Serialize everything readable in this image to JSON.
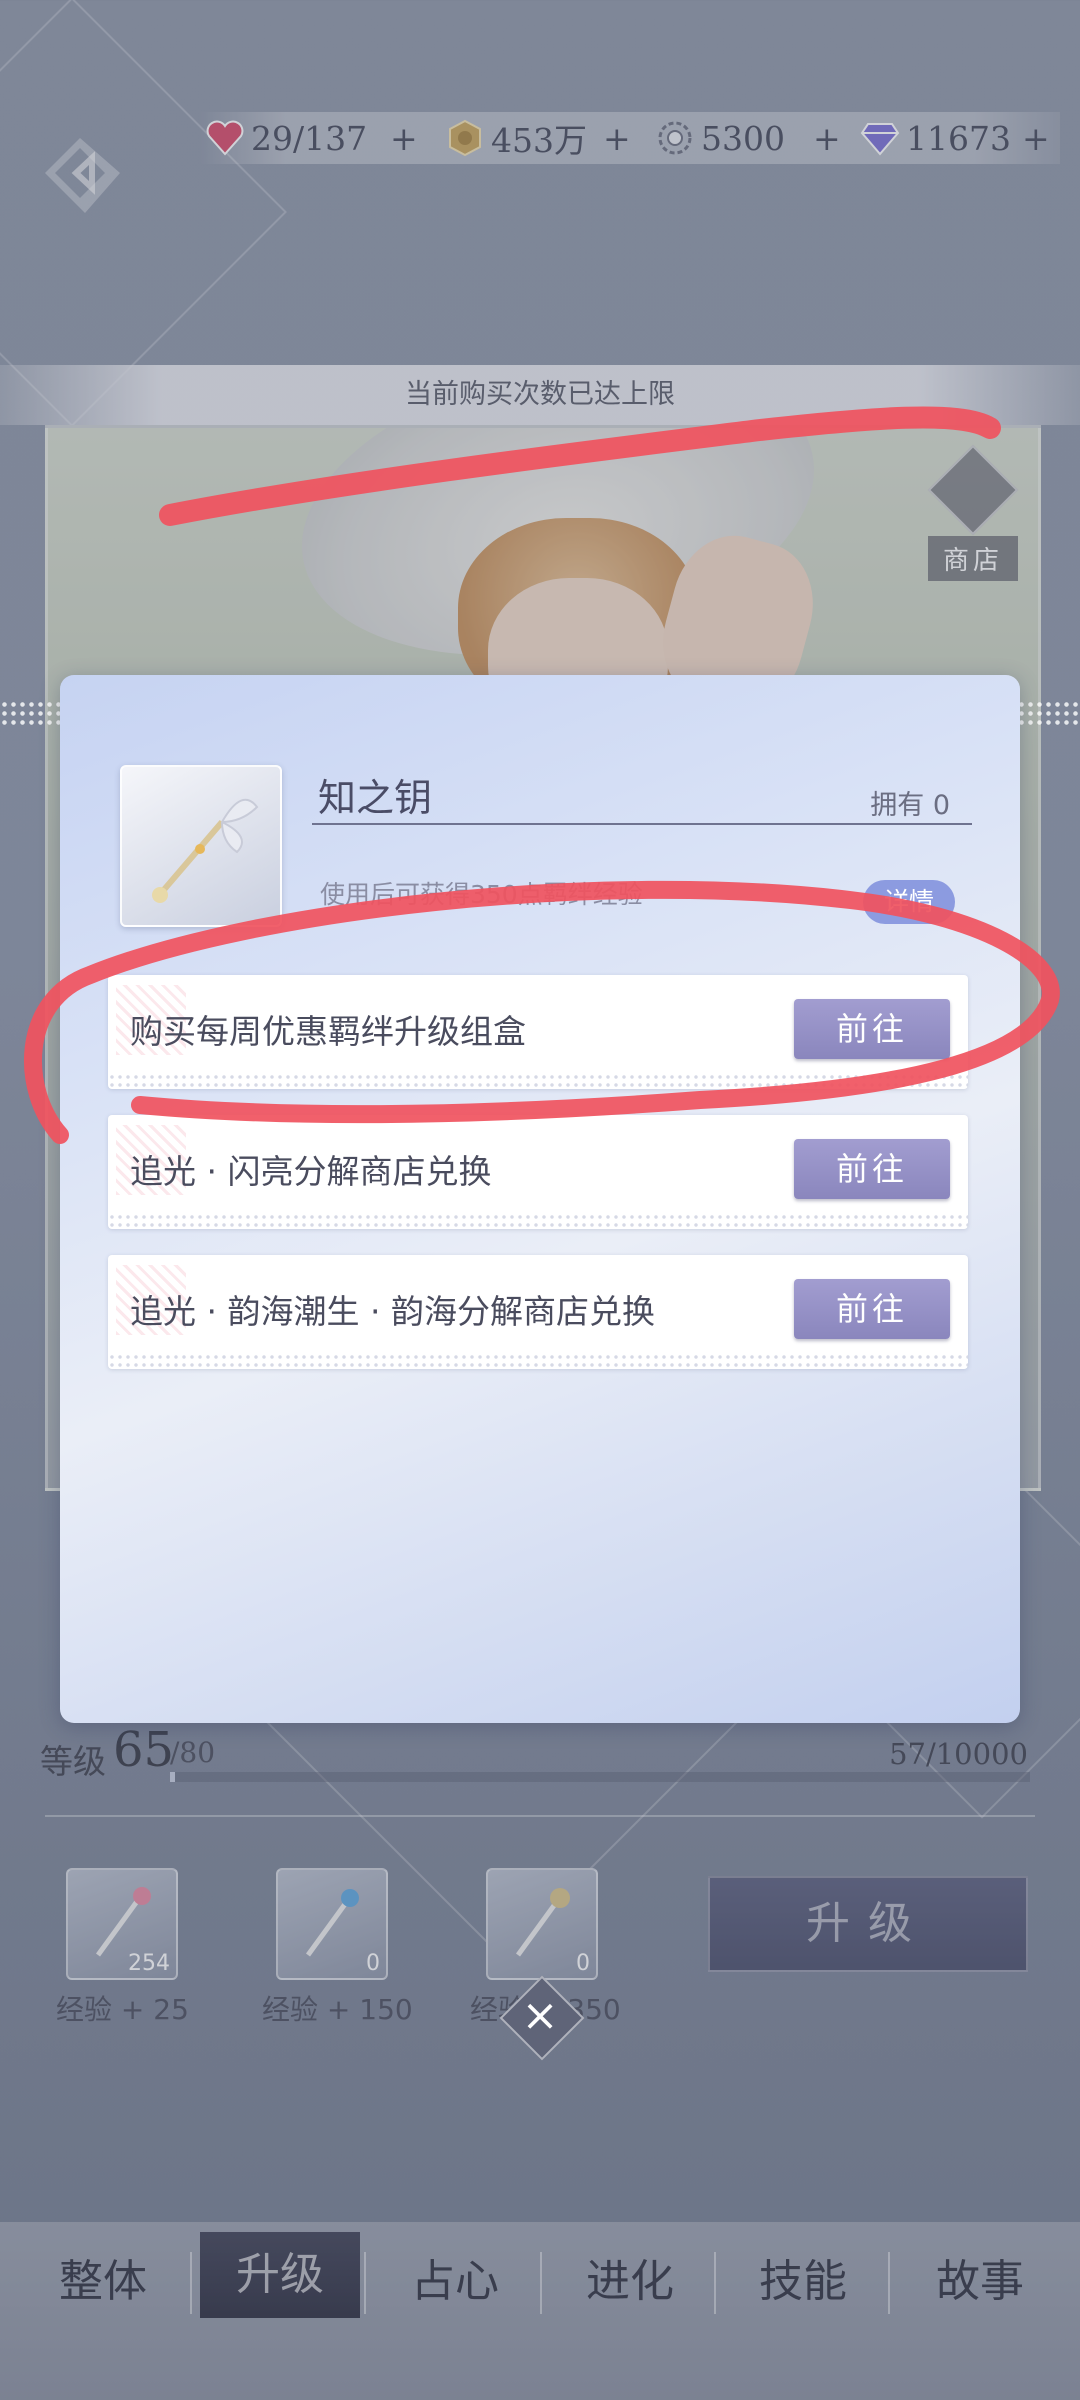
{
  "currencies": [
    {
      "icon": "heart-gem-icon",
      "value": "29/137"
    },
    {
      "icon": "gold-coin-icon",
      "value": "453万"
    },
    {
      "icon": "crystal-icon",
      "value": "5300"
    },
    {
      "icon": "diamond-icon",
      "value": "11673"
    }
  ],
  "plus_label": "+",
  "banner_text": "当前购买次数已达上限",
  "shop_label": "商店",
  "dialog": {
    "item_name": "知之钥",
    "owned": "拥有 0",
    "description": "使用后可获得350点羁绊经验",
    "detail_label": "详情",
    "sources": [
      {
        "text": "购买每周优惠羁绊升级组盒",
        "button": "前往"
      },
      {
        "text": "追光 · 闪亮分解商店兑换",
        "button": "前往"
      },
      {
        "text": "追光 · 韵海潮生 · 韵海分解商店兑换",
        "button": "前往"
      }
    ]
  },
  "level": {
    "label": "等级",
    "value": "65",
    "max": "/80",
    "exp": "57/10000",
    "exp_progress": 0.0057
  },
  "materials": [
    {
      "count": "254",
      "label": "经验 + 25"
    },
    {
      "count": "0",
      "label": "经验 + 150"
    },
    {
      "count": "0",
      "label": "经验 + 350"
    }
  ],
  "upgrade_label": "升级",
  "tabs": [
    "整体",
    "升级",
    "占心",
    "进化",
    "技能",
    "故事"
  ],
  "active_tab": "升级",
  "colors": {
    "annotation_red": "#f0535e",
    "button_purple": "#9590c8"
  }
}
